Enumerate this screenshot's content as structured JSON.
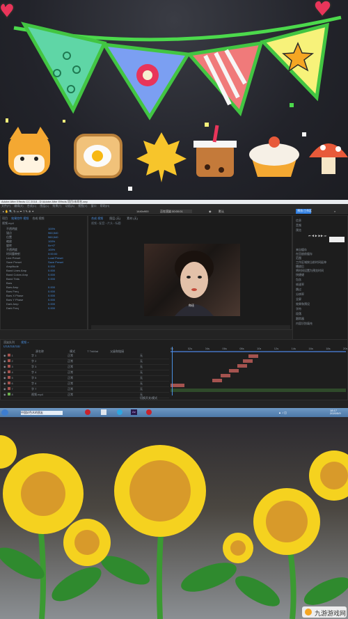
{
  "ae": {
    "title": "Adobe After Effects CC 2018 - D:\\Adobe After Effects 项目\\未命名.aep",
    "menu": [
      "文件(F)",
      "编辑(E)",
      "合成(C)",
      "图层(L)",
      "效果(T)",
      "动画(A)",
      "视图(V)",
      "窗口",
      "帮助(H)"
    ],
    "toolbar_res": "1440x900",
    "toolbar_time": "正在渲染 00:00:01",
    "workspace_tab": "默认",
    "left_tabs": [
      "项目",
      "效果控件 视频",
      "合成 视频"
    ],
    "project_label": "视频.mp4",
    "effect_rows": [
      "不透明度",
      "锚点",
      "位置",
      "缩放",
      "旋转",
      "不透明度",
      "时间重映射",
      "Line Preset",
      "Save Preset",
      "Amplitude",
      "Band Lines Amp",
      "Band Colors Amp",
      "Band Tints",
      "Bars",
      "Bars Amp",
      "Bars Freq",
      "Bars X Phase",
      "Bars Y Phase",
      "Dark Amp",
      "Dark Freq"
    ],
    "effect_values": [
      "100%",
      "960,540",
      "960,540",
      "100%",
      "0x+0°",
      "100%",
      "0:00:00",
      "Load Preset",
      "Save Preset",
      "0.000",
      "0.000",
      "0.000",
      "0.000",
      "",
      "0.000",
      "0.000",
      "0.000",
      "0.000",
      "0.000",
      "0.000"
    ],
    "viewer_tabs": [
      "合成 视频",
      "图层 (无)",
      "素材 (无)"
    ],
    "viewer_breadcrumb": "视频 › 配音 › 片头 › 标题",
    "viewer_caption": "你还",
    "right_panel": {
      "tab": "预览/工作区",
      "sections": [
        "信息",
        "音频",
        "预览",
        "快捷键",
        "包含",
        "帧速率",
        "跳过",
        "分辨率",
        "全屏",
        "效果和预设",
        "字符",
        "段落",
        "跟踪器",
        "内容识别填充"
      ],
      "checks": [
        "来自缓存",
        "在回放前缓存",
        "范围",
        "工作区域按当前时间延伸",
        "播放后",
        "将时间设置为预览时间"
      ]
    },
    "timeline": {
      "time": "0:00:00:00",
      "tabs": [
        "渲染队列",
        "视频 ×"
      ],
      "headers": [
        "源名称",
        "模式",
        "T TrkMat",
        "父级和链接"
      ],
      "layers": [
        {
          "num": "1",
          "name": "字 1",
          "mode": "正常",
          "parent": "无"
        },
        {
          "num": "2",
          "name": "字 2",
          "mode": "正常",
          "parent": "无"
        },
        {
          "num": "3",
          "name": "字 3",
          "mode": "正常",
          "parent": "无"
        },
        {
          "num": "4",
          "name": "字 4",
          "mode": "正常",
          "parent": "无"
        },
        {
          "num": "5",
          "name": "字 5",
          "mode": "正常",
          "parent": "无"
        },
        {
          "num": "6",
          "name": "字 6",
          "mode": "正常",
          "parent": "无"
        },
        {
          "num": "7",
          "name": "字 7",
          "mode": "正常",
          "parent": "无"
        },
        {
          "num": "8",
          "name": "视频.mp4",
          "mode": "正常",
          "parent": "无"
        }
      ],
      "ruler": [
        "0s",
        "02s",
        "04s",
        "06s",
        "08s",
        "10s",
        "12s",
        "14s",
        "16s",
        "18s",
        "20s"
      ],
      "footer": "切换开关/模式"
    },
    "taskbar": {
      "start": "开始",
      "apps": [
        "中国好色木的朋友",
        "Ae"
      ],
      "clock_time": "18:17",
      "clock_date": "2020/5/9"
    }
  },
  "watermark": "九游游戏网",
  "colors": {
    "accent": "#4a90e2",
    "ae_bg": "#232323",
    "clip_red": "#a5534f",
    "taskbar": "#5b89b8"
  }
}
